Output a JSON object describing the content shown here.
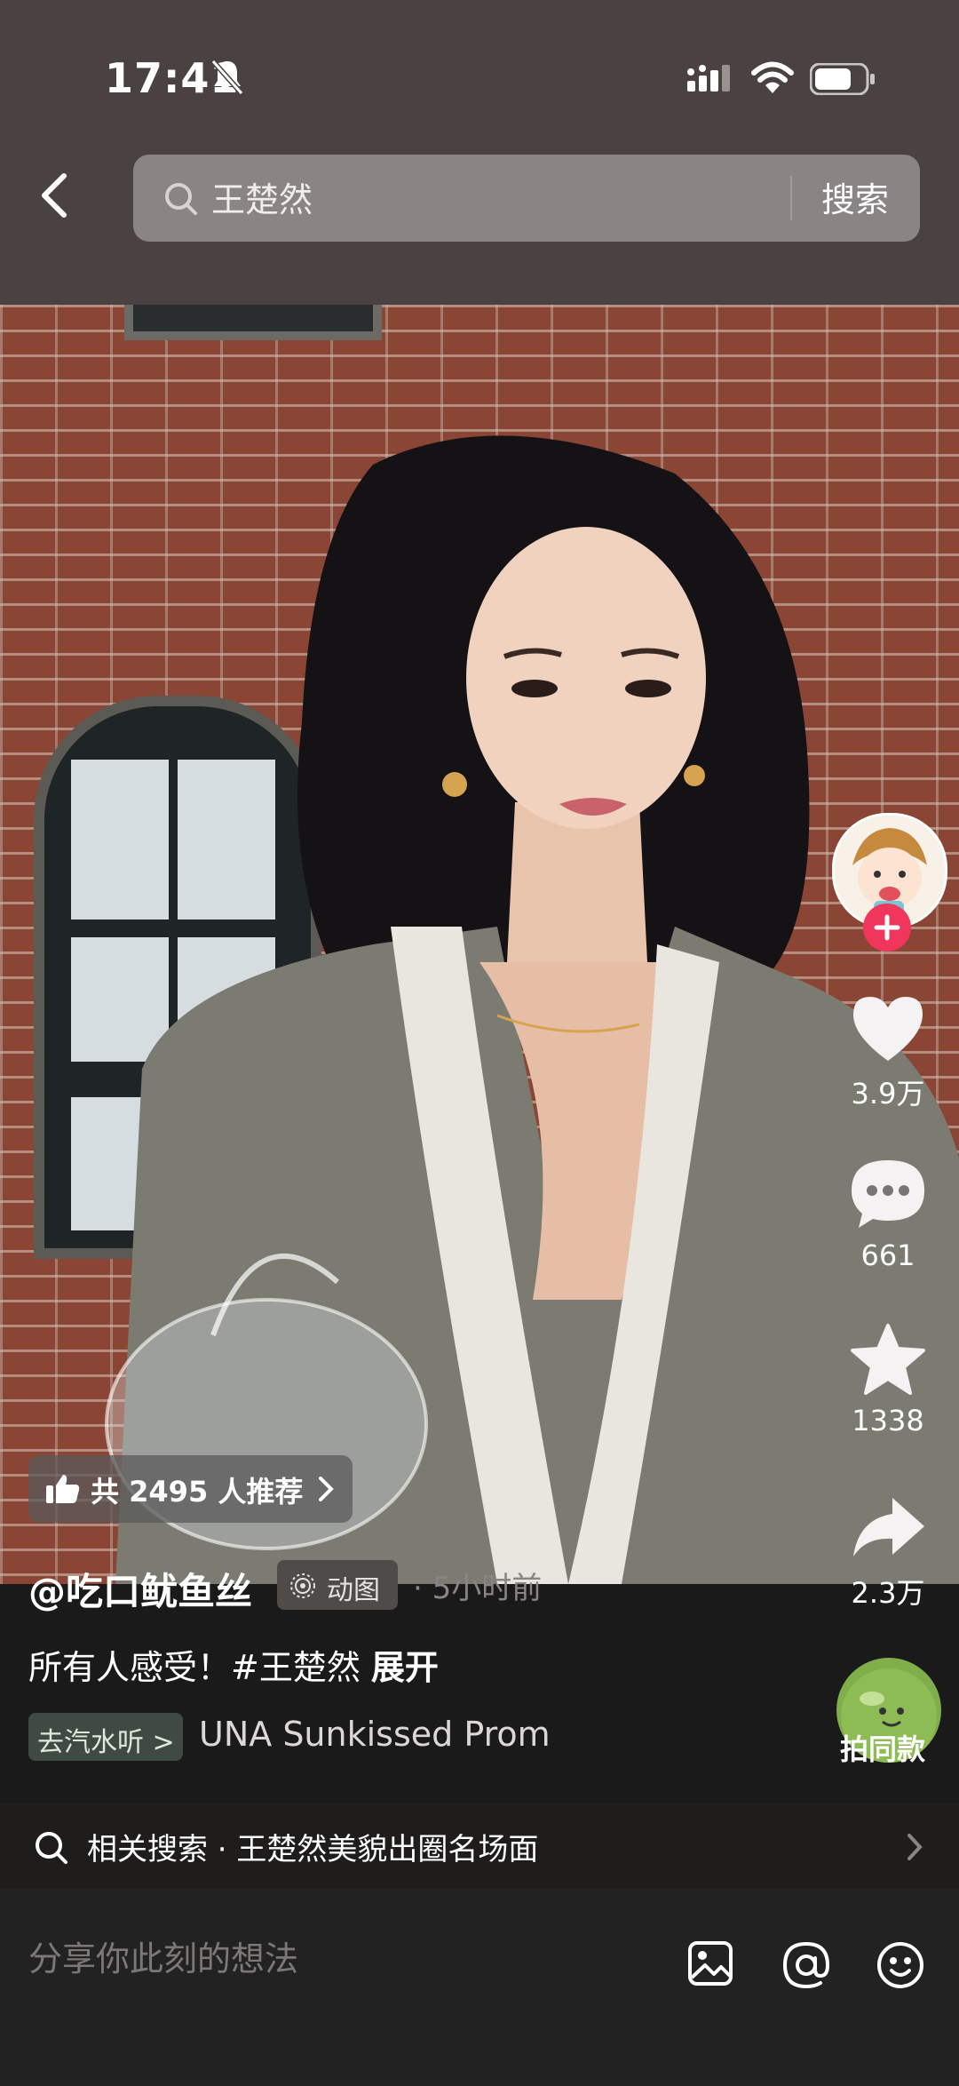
{
  "status_bar": {
    "time": "17:41"
  },
  "search": {
    "query": "王楚然",
    "button": "搜索"
  },
  "recommend": {
    "text": "共 2495 人推荐"
  },
  "post": {
    "author": "@吃口鱿鱼丝",
    "anim_tag": "动图",
    "time": "· 5小时前",
    "caption": "所有人感受！#王楚然",
    "expand": "展开",
    "music_tag": "去汽水听 >",
    "music_title": "UNA   Sunkissed Prom"
  },
  "actions": {
    "likes": "3.9万",
    "comments": "661",
    "favorites": "1338",
    "shares": "2.3万",
    "same_style": "拍同款"
  },
  "related": {
    "text": "相关搜索 · 王楚然美貌出圈名场面"
  },
  "composer": {
    "placeholder": "分享你此刻的想法"
  }
}
